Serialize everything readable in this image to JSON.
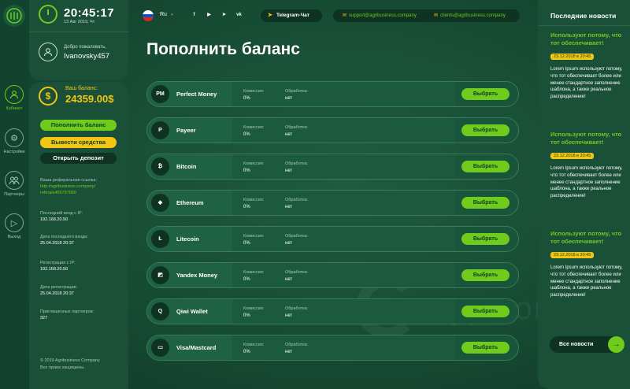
{
  "nav": {
    "items": [
      {
        "label": "Кабинет",
        "icon": "user-icon"
      },
      {
        "label": "Настройки",
        "icon": "gear-icon"
      },
      {
        "label": "Партнеры",
        "icon": "partners-icon"
      },
      {
        "label": "Выход",
        "icon": "play-icon"
      }
    ]
  },
  "header_left": {
    "time": "20:45:17",
    "date": "13 Авг 2019, Чт",
    "welcome": "Добро пожаловать,",
    "username": "Ivanovsky457"
  },
  "balance": {
    "label": "Ваш баланс:",
    "value": "24359.00$"
  },
  "actions": {
    "deposit": "Пополнить баланс",
    "withdraw": "Вывести средства",
    "open_deposit": "Открыть депозит"
  },
  "account_info": {
    "ref_label": "Ваша реферальная ссылка:",
    "ref_link_1": "http://agribusiness.company/",
    "ref_link_2": "referals456787889",
    "last_ip_label": "Последний вход с IP:",
    "last_ip": "192.168.20.50",
    "last_date_label": "Дата последнего входа:",
    "last_date": "25.04.2018  20:37",
    "reg_ip_label": "Регистрация с IP:",
    "reg_ip": "192.168.20.50",
    "reg_date_label": "Дата регистрации:",
    "reg_date": "25.04.2018  20:37",
    "partners_label": "Приглашенных партнеров:",
    "partners": "327"
  },
  "footer": {
    "copyright": "© 2019  Agribusiness Company",
    "rights": "Все права защищены."
  },
  "header": {
    "language": "Ru",
    "socials": [
      "f",
      "▶",
      "➤",
      "vk"
    ],
    "telegram": "Telegram-Чат",
    "email_support": "support@agribusiness.company",
    "email_clients": "clients@agribusiness.company"
  },
  "page": {
    "title": "Пополнить баланс"
  },
  "payment_labels": {
    "commission": "Комиссия:",
    "processing": "Обработка:",
    "select": "Выбрать"
  },
  "payments": [
    {
      "name": "Perfect Money",
      "icon": "PM",
      "commission": "0%",
      "processing": "нет"
    },
    {
      "name": "Payeer",
      "icon": "P",
      "commission": "0%",
      "processing": "нет"
    },
    {
      "name": "Bitcoin",
      "icon": "₿",
      "commission": "0%",
      "processing": "нет"
    },
    {
      "name": "Ethereum",
      "icon": "◆",
      "commission": "0%",
      "processing": "нет"
    },
    {
      "name": "Litecoin",
      "icon": "Ł",
      "commission": "0%",
      "processing": "нет"
    },
    {
      "name": "Yandex Money",
      "icon": "◩",
      "commission": "0%",
      "processing": "нет"
    },
    {
      "name": "Qiwi Wallet",
      "icon": "Q",
      "commission": "0%",
      "processing": "нет"
    },
    {
      "name": "Visa/Mastcard",
      "icon": "▭",
      "commission": "0%",
      "processing": "нет"
    }
  ],
  "watermark": "nyp.com",
  "news": {
    "title": "Последние новости",
    "items": [
      {
        "headline": "Используют потому, что тот обеспечивает!",
        "date": "23.12.2018 в 20:45",
        "text": "Lorem Ipsum используют потому, что тот обеспечивает более или менее стандартное заполнение шаблона, а также реальное распределение!"
      },
      {
        "headline": "Используют потому, что тот обеспечивает!",
        "date": "23.12.2018 в 20:45",
        "text": "Lorem Ipsum используют потому, что тот обеспечивает более или менее стандартное заполнение шаблона, а также реальное распределение!"
      },
      {
        "headline": "Используют потому, что тот обеспечивает!",
        "date": "23.12.2018 в 20:45",
        "text": "Lorem Ipsum используют потому, что тот обеспечивает более или менее стандартное заполнение шаблона, а также реальное распределение!"
      }
    ],
    "all_label": "Все новости"
  },
  "colors": {
    "accent_green": "#6fcb1c",
    "accent_yellow": "#f3c614",
    "panel": "#1a5038",
    "background": "#144a33"
  }
}
